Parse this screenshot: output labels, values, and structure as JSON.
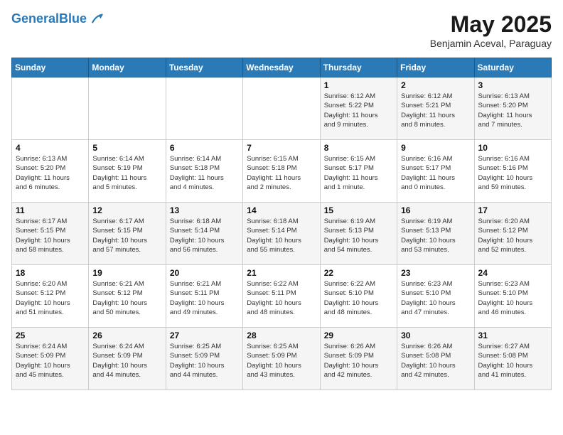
{
  "logo": {
    "line1": "General",
    "line2": "Blue"
  },
  "title": {
    "month_year": "May 2025",
    "location": "Benjamin Aceval, Paraguay"
  },
  "weekdays": [
    "Sunday",
    "Monday",
    "Tuesday",
    "Wednesday",
    "Thursday",
    "Friday",
    "Saturday"
  ],
  "weeks": [
    [
      {
        "day": "",
        "info": ""
      },
      {
        "day": "",
        "info": ""
      },
      {
        "day": "",
        "info": ""
      },
      {
        "day": "",
        "info": ""
      },
      {
        "day": "1",
        "info": "Sunrise: 6:12 AM\nSunset: 5:22 PM\nDaylight: 11 hours\nand 9 minutes."
      },
      {
        "day": "2",
        "info": "Sunrise: 6:12 AM\nSunset: 5:21 PM\nDaylight: 11 hours\nand 8 minutes."
      },
      {
        "day": "3",
        "info": "Sunrise: 6:13 AM\nSunset: 5:20 PM\nDaylight: 11 hours\nand 7 minutes."
      }
    ],
    [
      {
        "day": "4",
        "info": "Sunrise: 6:13 AM\nSunset: 5:20 PM\nDaylight: 11 hours\nand 6 minutes."
      },
      {
        "day": "5",
        "info": "Sunrise: 6:14 AM\nSunset: 5:19 PM\nDaylight: 11 hours\nand 5 minutes."
      },
      {
        "day": "6",
        "info": "Sunrise: 6:14 AM\nSunset: 5:18 PM\nDaylight: 11 hours\nand 4 minutes."
      },
      {
        "day": "7",
        "info": "Sunrise: 6:15 AM\nSunset: 5:18 PM\nDaylight: 11 hours\nand 2 minutes."
      },
      {
        "day": "8",
        "info": "Sunrise: 6:15 AM\nSunset: 5:17 PM\nDaylight: 11 hours\nand 1 minute."
      },
      {
        "day": "9",
        "info": "Sunrise: 6:16 AM\nSunset: 5:17 PM\nDaylight: 11 hours\nand 0 minutes."
      },
      {
        "day": "10",
        "info": "Sunrise: 6:16 AM\nSunset: 5:16 PM\nDaylight: 10 hours\nand 59 minutes."
      }
    ],
    [
      {
        "day": "11",
        "info": "Sunrise: 6:17 AM\nSunset: 5:15 PM\nDaylight: 10 hours\nand 58 minutes."
      },
      {
        "day": "12",
        "info": "Sunrise: 6:17 AM\nSunset: 5:15 PM\nDaylight: 10 hours\nand 57 minutes."
      },
      {
        "day": "13",
        "info": "Sunrise: 6:18 AM\nSunset: 5:14 PM\nDaylight: 10 hours\nand 56 minutes."
      },
      {
        "day": "14",
        "info": "Sunrise: 6:18 AM\nSunset: 5:14 PM\nDaylight: 10 hours\nand 55 minutes."
      },
      {
        "day": "15",
        "info": "Sunrise: 6:19 AM\nSunset: 5:13 PM\nDaylight: 10 hours\nand 54 minutes."
      },
      {
        "day": "16",
        "info": "Sunrise: 6:19 AM\nSunset: 5:13 PM\nDaylight: 10 hours\nand 53 minutes."
      },
      {
        "day": "17",
        "info": "Sunrise: 6:20 AM\nSunset: 5:12 PM\nDaylight: 10 hours\nand 52 minutes."
      }
    ],
    [
      {
        "day": "18",
        "info": "Sunrise: 6:20 AM\nSunset: 5:12 PM\nDaylight: 10 hours\nand 51 minutes."
      },
      {
        "day": "19",
        "info": "Sunrise: 6:21 AM\nSunset: 5:12 PM\nDaylight: 10 hours\nand 50 minutes."
      },
      {
        "day": "20",
        "info": "Sunrise: 6:21 AM\nSunset: 5:11 PM\nDaylight: 10 hours\nand 49 minutes."
      },
      {
        "day": "21",
        "info": "Sunrise: 6:22 AM\nSunset: 5:11 PM\nDaylight: 10 hours\nand 48 minutes."
      },
      {
        "day": "22",
        "info": "Sunrise: 6:22 AM\nSunset: 5:10 PM\nDaylight: 10 hours\nand 48 minutes."
      },
      {
        "day": "23",
        "info": "Sunrise: 6:23 AM\nSunset: 5:10 PM\nDaylight: 10 hours\nand 47 minutes."
      },
      {
        "day": "24",
        "info": "Sunrise: 6:23 AM\nSunset: 5:10 PM\nDaylight: 10 hours\nand 46 minutes."
      }
    ],
    [
      {
        "day": "25",
        "info": "Sunrise: 6:24 AM\nSunset: 5:09 PM\nDaylight: 10 hours\nand 45 minutes."
      },
      {
        "day": "26",
        "info": "Sunrise: 6:24 AM\nSunset: 5:09 PM\nDaylight: 10 hours\nand 44 minutes."
      },
      {
        "day": "27",
        "info": "Sunrise: 6:25 AM\nSunset: 5:09 PM\nDaylight: 10 hours\nand 44 minutes."
      },
      {
        "day": "28",
        "info": "Sunrise: 6:25 AM\nSunset: 5:09 PM\nDaylight: 10 hours\nand 43 minutes."
      },
      {
        "day": "29",
        "info": "Sunrise: 6:26 AM\nSunset: 5:09 PM\nDaylight: 10 hours\nand 42 minutes."
      },
      {
        "day": "30",
        "info": "Sunrise: 6:26 AM\nSunset: 5:08 PM\nDaylight: 10 hours\nand 42 minutes."
      },
      {
        "day": "31",
        "info": "Sunrise: 6:27 AM\nSunset: 5:08 PM\nDaylight: 10 hours\nand 41 minutes."
      }
    ]
  ]
}
